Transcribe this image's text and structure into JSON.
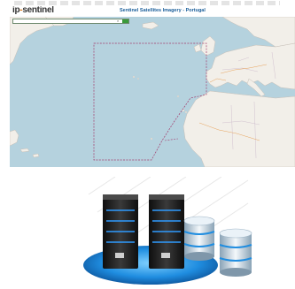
{
  "app": {
    "logo_text": "ip-sentinel",
    "page_title": "Sentinel Satellites Imagery - Portugal"
  },
  "search": {
    "placeholder": "",
    "icon": "search-icon",
    "button_icon": "go-icon"
  },
  "colors": {
    "ocean": "#b5d2de",
    "land": "#f2efe9",
    "accent_green": "#3a9a3a",
    "title_blue": "#1a5e9a",
    "boundary": "#a33a6a",
    "server_blue": "#1f8de0"
  },
  "illustration": {
    "subject": "server-and-database-illustration"
  }
}
